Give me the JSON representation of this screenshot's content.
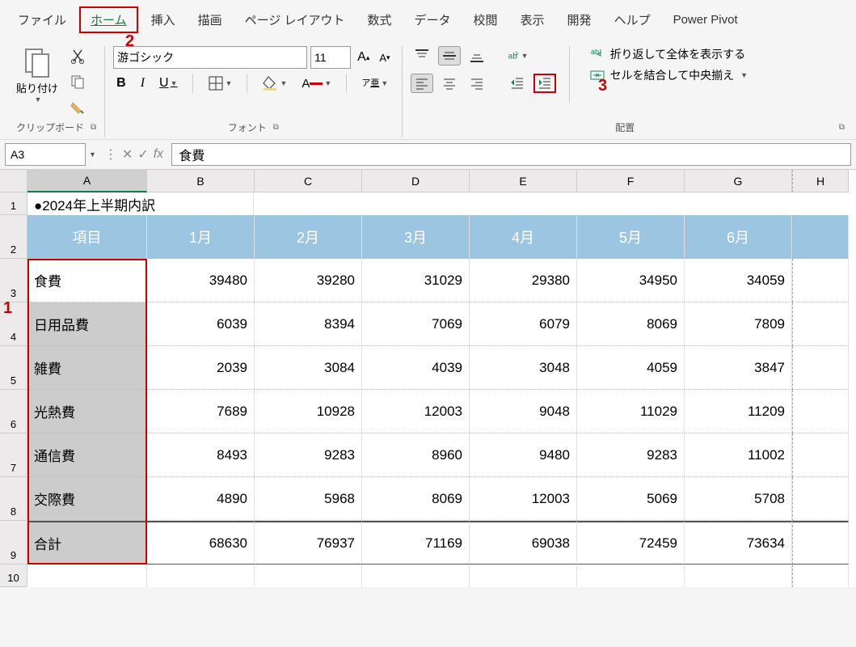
{
  "menu": {
    "items": [
      "ファイル",
      "ホーム",
      "挿入",
      "描画",
      "ページ レイアウト",
      "数式",
      "データ",
      "校閲",
      "表示",
      "開発",
      "ヘルプ",
      "Power Pivot"
    ],
    "activeIndex": 1
  },
  "ribbon": {
    "clipboard": {
      "paste_label": "貼り付け",
      "group_label": "クリップボード"
    },
    "font": {
      "font_name": "游ゴシック",
      "font_size": "11",
      "group_label": "フォント"
    },
    "alignment": {
      "wrap_label": "折り返して全体を表示する",
      "merge_label": "セルを結合して中央揃え",
      "group_label": "配置"
    }
  },
  "formula_bar": {
    "cell_ref": "A3",
    "formula": "食費"
  },
  "columns": [
    "A",
    "B",
    "C",
    "D",
    "E",
    "F",
    "G",
    "H"
  ],
  "sheet": {
    "title": "●2024年上半期内訳",
    "header": [
      "項目",
      "1月",
      "2月",
      "3月",
      "4月",
      "5月",
      "6月"
    ],
    "rows": [
      {
        "label": "食費",
        "vals": [
          39480,
          39280,
          31029,
          29380,
          34950,
          34059
        ]
      },
      {
        "label": "日用品費",
        "vals": [
          6039,
          8394,
          7069,
          6079,
          8069,
          7809
        ]
      },
      {
        "label": "雑費",
        "vals": [
          2039,
          3084,
          4039,
          3048,
          4059,
          3847
        ]
      },
      {
        "label": "光熱費",
        "vals": [
          7689,
          10928,
          12003,
          9048,
          11029,
          11209
        ]
      },
      {
        "label": "通信費",
        "vals": [
          8493,
          9283,
          8960,
          9480,
          9283,
          11002
        ]
      },
      {
        "label": "交際費",
        "vals": [
          4890,
          5968,
          8069,
          12003,
          5069,
          5708
        ]
      },
      {
        "label": "合計",
        "vals": [
          68630,
          76937,
          71169,
          69038,
          72459,
          73634
        ]
      }
    ]
  },
  "annotations": {
    "a1": "1",
    "a2": "2",
    "a3": "3"
  }
}
